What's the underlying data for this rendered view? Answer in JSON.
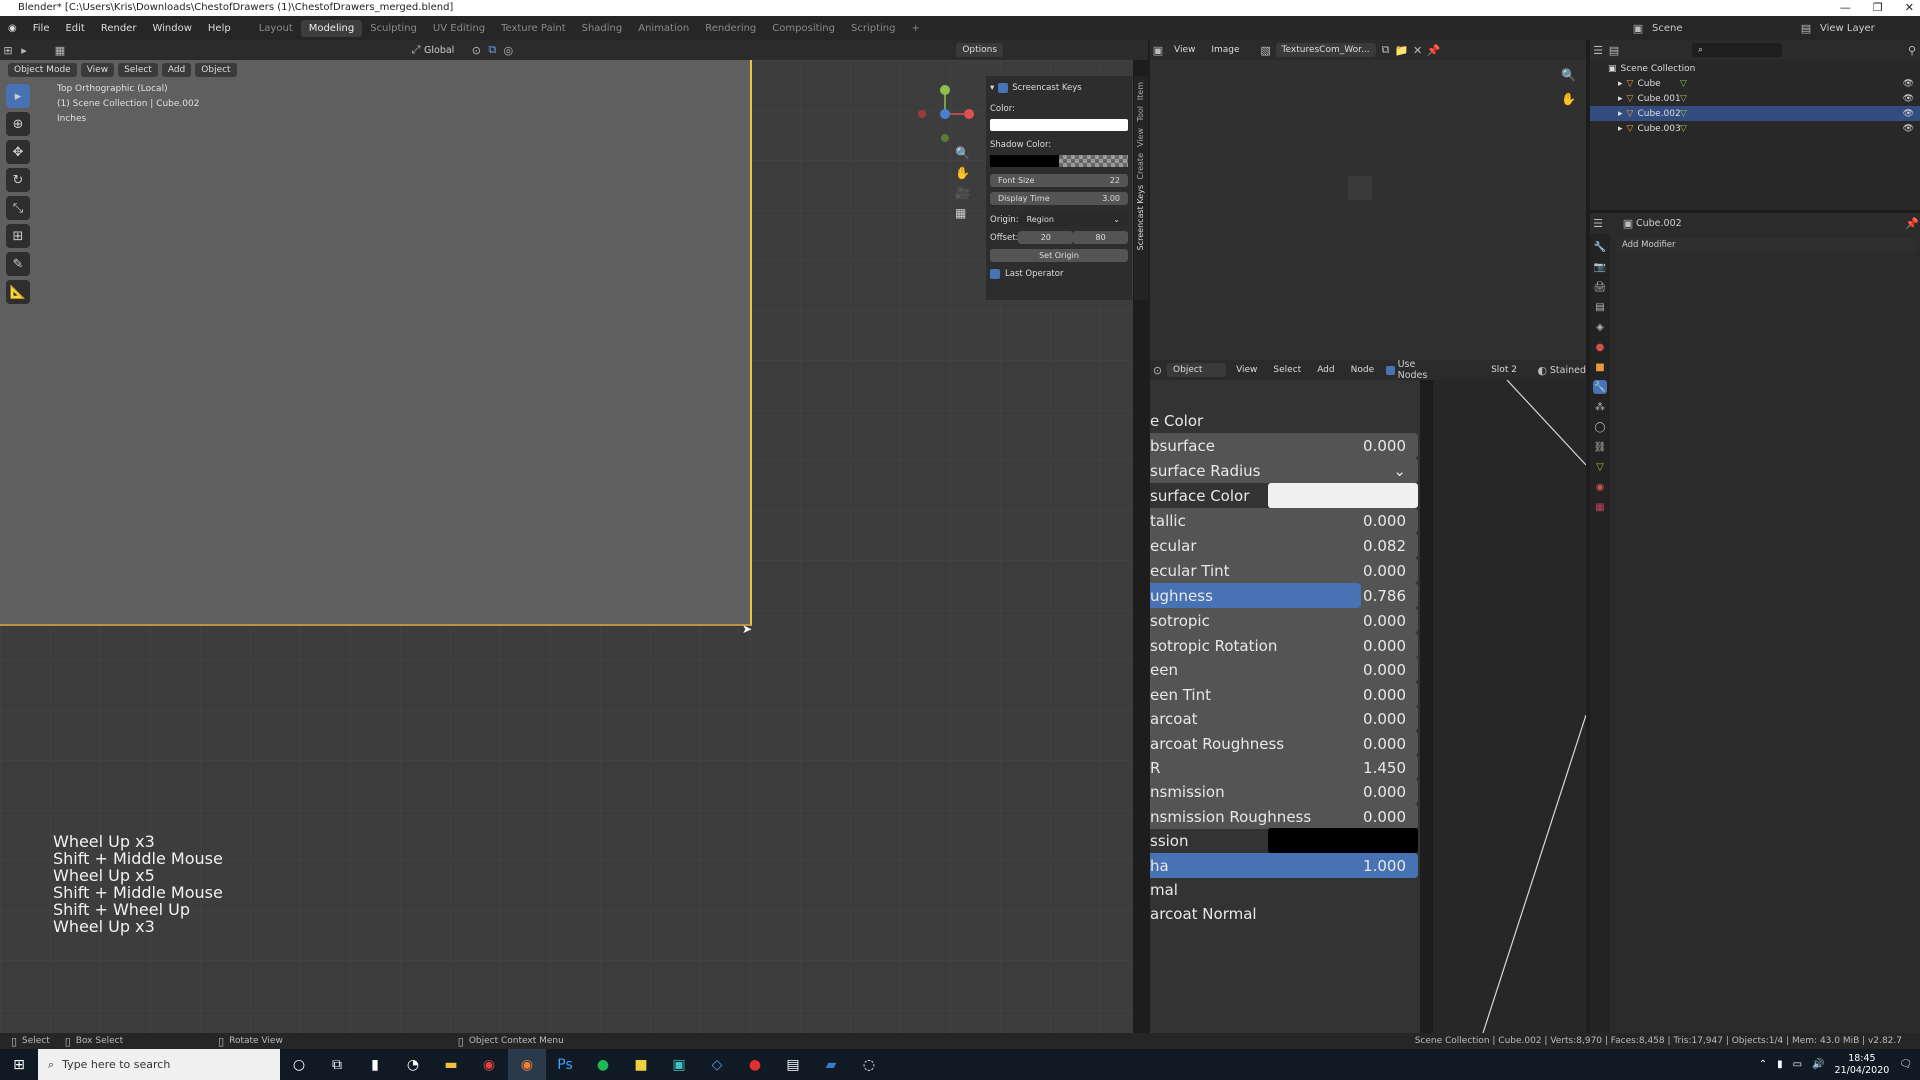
{
  "window": {
    "title": "Blender* [C:\\Users\\Kris\\Downloads\\ChestofDrawers (1)\\ChestofDrawers_merged.blend]"
  },
  "menu": [
    "File",
    "Edit",
    "Render",
    "Window",
    "Help"
  ],
  "workspaces": [
    "Layout",
    "Modeling",
    "Sculpting",
    "UV Editing",
    "Texture Paint",
    "Shading",
    "Animation",
    "Rendering",
    "Compositing",
    "Scripting",
    "+"
  ],
  "active_workspace": "Modeling",
  "scene": {
    "label": "Scene",
    "view_layer": "View Layer"
  },
  "viewport": {
    "mode": "Object Mode",
    "menus": [
      "View",
      "Select",
      "Add",
      "Object"
    ],
    "transform": "Global",
    "options": "Options",
    "info": [
      "Top Orthographic (Local)",
      "(1) Scene Collection | Cube.002",
      "Inches"
    ]
  },
  "screencast_keys": {
    "lines": [
      "Wheel Up x3",
      "Shift + Middle Mouse",
      "Wheel Up x5",
      "Shift + Middle Mouse",
      "Shift + Wheel Up",
      "Wheel Up x3"
    ]
  },
  "npanel": {
    "header": "Screencast Keys",
    "color_label": "Color:",
    "shadow_label": "Shadow Color:",
    "font_size_label": "Font Size",
    "font_size": "22",
    "display_time_label": "Display Time",
    "display_time": "3.00",
    "origin_label": "Origin:",
    "origin_value": "Region",
    "offset_label": "Offset:",
    "offset_x": "20",
    "offset_y": "80",
    "set_origin": "Set Origin",
    "last_operator": "Last Operator",
    "tabs": [
      "Item",
      "Tool",
      "View",
      "Create",
      "Screencast Keys"
    ]
  },
  "image_editor": {
    "menus": [
      "View",
      "Image"
    ],
    "image_name": "TexturesCom_Wor..."
  },
  "node_editor": {
    "object": "Object",
    "menus": [
      "View",
      "Select",
      "Add",
      "Node"
    ],
    "use_nodes": "Use Nodes",
    "slot": "Slot 2",
    "material": "Stained"
  },
  "bsdf": [
    {
      "label": "e Color",
      "type": "label"
    },
    {
      "label": "bsurface",
      "value": "0.000",
      "type": "field"
    },
    {
      "label": "surface Radius",
      "value": "⌄",
      "type": "dropdown"
    },
    {
      "label": "surface Color",
      "type": "color",
      "color": "#f0f0f0"
    },
    {
      "label": "tallic",
      "value": "0.000",
      "type": "field"
    },
    {
      "label": "ecular",
      "value": "0.082",
      "type": "field"
    },
    {
      "label": "ecular Tint",
      "value": "0.000",
      "type": "field"
    },
    {
      "label": "ughness",
      "value": "0.786",
      "type": "slider",
      "fill": 0.786
    },
    {
      "label": "sotropic",
      "value": "0.000",
      "type": "field"
    },
    {
      "label": "sotropic Rotation",
      "value": "0.000",
      "type": "field"
    },
    {
      "label": "een",
      "value": "0.000",
      "type": "field"
    },
    {
      "label": "een Tint",
      "value": "0.000",
      "type": "field"
    },
    {
      "label": "arcoat",
      "value": "0.000",
      "type": "field"
    },
    {
      "label": "arcoat Roughness",
      "value": "0.000",
      "type": "field"
    },
    {
      "label": "R",
      "value": "1.450",
      "type": "field"
    },
    {
      "label": "nsmission",
      "value": "0.000",
      "type": "field"
    },
    {
      "label": "nsmission Roughness",
      "value": "0.000",
      "type": "field"
    },
    {
      "label": "ssion",
      "type": "color",
      "color": "#000000"
    },
    {
      "label": "ha",
      "value": "1.000",
      "type": "slider",
      "fill": 1.0
    },
    {
      "label": "mal",
      "type": "label"
    },
    {
      "label": "arcoat Normal",
      "type": "label"
    }
  ],
  "outliner": {
    "root": "Scene Collection",
    "items": [
      "Cube",
      "Cube.001",
      "Cube.002",
      "Cube.003"
    ],
    "selected": "Cube.002"
  },
  "properties": {
    "object": "Cube.002",
    "add_modifier": "Add Modifier"
  },
  "status": {
    "left": [
      "Select",
      "Box Select",
      "Rotate View",
      "Object Context Menu"
    ],
    "right": "Scene Collection | Cube.002 | Verts:8,970 | Faces:8,458 | Tris:17,947 | Objects:1/4 | Mem: 43.0 MiB | v2.82.7"
  },
  "taskbar": {
    "search": "Type here to search",
    "time": "18:45",
    "date": "21/04/2020"
  },
  "colors": {
    "accent": "#4772b3",
    "outline": "#f0c040"
  }
}
